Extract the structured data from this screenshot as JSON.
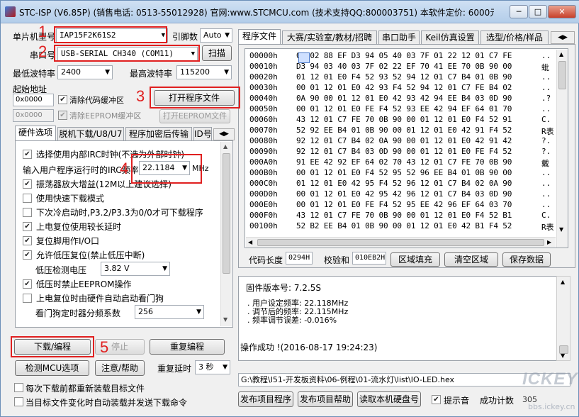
{
  "window": {
    "title": "STC-ISP (V6.85P) (销售电话: 0513-55012928) 官网:www.STCMCU.com (技术支持QQ:800003751) 本软件定价: 6000元(",
    "minimize": "─",
    "restore": "□",
    "close": "✕"
  },
  "left": {
    "mcu_label": "单片机型号",
    "mcu_value": "IAP15F2K61S2",
    "pins_label": "引脚数",
    "pins_value": "Auto",
    "port_label": "串口号",
    "port_value": "USB-SERIAL CH340 (COM11)",
    "scan_button": "扫描",
    "min_baud_label": "最低波特率",
    "min_baud_value": "2400",
    "max_baud_label": "最高波特率",
    "max_baud_value": "115200",
    "start_addr_label": "起始地址",
    "addr1": "0x0000",
    "addr2": "0x0000",
    "clear_code_label": "清除代码缓冲区",
    "clear_eeprom_label": "清除EEPROM缓冲区",
    "open_program_button": "打开程序文件",
    "open_eeprom_button": "打开EEPROM文件",
    "tabs": [
      "硬件选项",
      "脱机下载/U8/U7",
      "程序加密后传输",
      "ID号"
    ],
    "options": [
      {
        "checked": true,
        "label": "选择使用内部IRC时钟(不选为外部时钟)"
      },
      {
        "checked": true,
        "label": "振荡器放大增益(12M以上建议选择)"
      },
      {
        "checked": false,
        "label": "使用快速下载模式"
      },
      {
        "checked": false,
        "label": "下次冷启动时,P3.2/P3.3为0/0才可下载程序"
      },
      {
        "checked": true,
        "label": "上电复位使用较长延时"
      },
      {
        "checked": true,
        "label": "复位脚用作I/O口"
      },
      {
        "checked": true,
        "label": "允许低压复位(禁止低压中断)"
      },
      {
        "checked": true,
        "label": "低压时禁止EEPROM操作"
      },
      {
        "checked": false,
        "label": "上电复位时由硬件自动启动看门狗"
      }
    ],
    "irc_label": "输入用户程序运行时的IRC频率",
    "irc_value": "22.1184",
    "irc_unit": "MHz",
    "lvd_label": "低压检测电压",
    "lvd_value": "3.82 V",
    "wdt_label": "看门狗定时器分频系数",
    "wdt_value": "256",
    "download_button": "下载/编程",
    "stop_button": "停止",
    "reprogram_button": "重复编程",
    "check_mcu_button": "检测MCU选项",
    "help_button": "注意/帮助",
    "retry_delay_label": "重复延时",
    "retry_delay_value": "3 秒",
    "reload_label": "每次下载前都重新装载目标文件",
    "auto_load_label": "当目标文件变化时自动装载并发送下载命令"
  },
  "annotations": [
    "1",
    "2",
    "3",
    "4",
    "5"
  ],
  "right": {
    "tabs": [
      "程序文件",
      "大赛/实验室/教材/招聘",
      "串口助手",
      "Keil仿真设置",
      "选型/价格/样品"
    ],
    "hex_rows": [
      {
        "addr": "00000h",
        "bytes": "02 02 88 EF D3 94 05 40 03 7F 01 22 12 01 C7 FE",
        "ascii": ".."
      },
      {
        "addr": "00010h",
        "bytes": "D3 94 03 40 03 7F 02 22 EF 70 41 EE 70 0B 90 00",
        "ascii": "蚍"
      },
      {
        "addr": "00020h",
        "bytes": "01 12 01 E0 F4 52 93 52 94 12 01 C7 B4 01 0B 90",
        "ascii": ".."
      },
      {
        "addr": "00030h",
        "bytes": "00 01 12 01 E0 42 93 F4 52 94 12 01 C7 FE B4 02",
        "ascii": ".."
      },
      {
        "addr": "00040h",
        "bytes": "0A 90 00 01 12 01 E0 42 93 42 94 EE B4 03 0D 90",
        "ascii": ".?"
      },
      {
        "addr": "00050h",
        "bytes": "00 01 12 01 E0 FE F4 52 93 EE 42 94 EF 64 01 70",
        "ascii": ".."
      },
      {
        "addr": "00060h",
        "bytes": "43 12 01 C7 FE 70 0B 90 00 01 12 01 E0 F4 52 91",
        "ascii": "C."
      },
      {
        "addr": "00070h",
        "bytes": "52 92 EE B4 01 0B 90 00 01 12 01 E0 42 91 F4 52",
        "ascii": "R表"
      },
      {
        "addr": "00080h",
        "bytes": "92 12 01 C7 B4 02 0A 90 00 01 12 01 E0 42 91 42",
        "ascii": "?."
      },
      {
        "addr": "00090h",
        "bytes": "92 12 01 C7 B4 03 0D 90 00 01 12 01 E0 FE F4 52",
        "ascii": "?."
      },
      {
        "addr": "000A0h",
        "bytes": "91 EE 42 92 EF 64 02 70 43 12 01 C7 FE 70 0B 90",
        "ascii": "戴"
      },
      {
        "addr": "000B0h",
        "bytes": "00 01 12 01 E0 F4 52 95 52 96 EE B4 01 0B 90 00",
        "ascii": ".."
      },
      {
        "addr": "000C0h",
        "bytes": "01 12 01 E0 42 95 F4 52 96 12 01 C7 B4 02 0A 90",
        "ascii": ".."
      },
      {
        "addr": "000D0h",
        "bytes": "00 01 12 01 E0 42 95 42 96 12 01 C7 B4 03 0D 90",
        "ascii": ".."
      },
      {
        "addr": "000E0h",
        "bytes": "00 01 12 01 E0 FE F4 52 95 EE 42 96 EF 64 03 70",
        "ascii": ".."
      },
      {
        "addr": "000F0h",
        "bytes": "43 12 01 C7 FE 70 0B 90 00 01 12 01 E0 F4 52 B1",
        "ascii": "C."
      },
      {
        "addr": "00100h",
        "bytes": "52 B2 EE B4 01 0B 90 00 01 12 01 E0 42 B1 F4 52",
        "ascii": "R表"
      }
    ],
    "code_len_label": "代码长度",
    "code_len": "0294H",
    "checksum_label": "校验和",
    "checksum": "010EB2H",
    "fill_button": "区域填充",
    "clear_button": "清空区域",
    "save_button": "保存数据",
    "log": [
      "固件版本号: 7.2.5S",
      ". 用户设定频率: 22.118MHz",
      ". 调节后的频率: 22.115MHz",
      ". 频率调节误差: -0.016%",
      "操作成功 !(2016-08-17 19:24:23)"
    ],
    "path": "G:\\教程\\I51-开发板资料\\06-例程\\01-流水灯\\list\\IO-LED.hex",
    "publish_button": "发布项目程序",
    "publish_help_button": "发布项目帮助",
    "read_disk_button": "读取本机硬盘号",
    "sound_label": "提示音",
    "success_count_label": "成功计数",
    "success_count": "305"
  },
  "watermark": {
    "brand": "ICKEY",
    "url": "bbs.ickey.cn"
  }
}
